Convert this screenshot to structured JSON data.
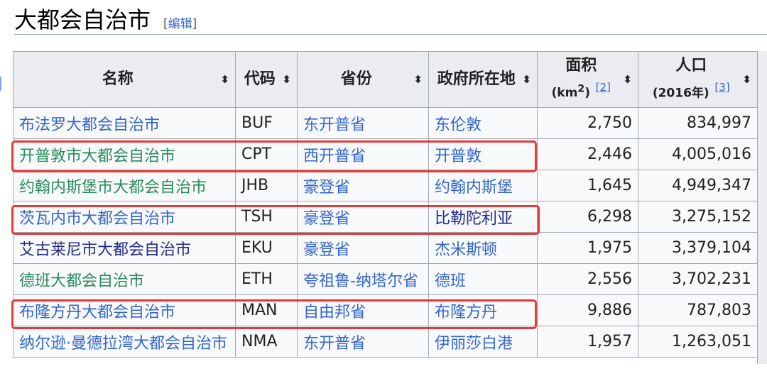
{
  "section": {
    "title": "大都会自治市",
    "edit_open": "[",
    "edit_label": "编辑",
    "edit_close": "]"
  },
  "table": {
    "headers": {
      "name": "名称",
      "code": "代码",
      "province": "省份",
      "seat": "政府所在地",
      "area_title": "面积",
      "area_unit_prefix": "(km",
      "area_unit_sup": "2",
      "area_unit_suffix": ")",
      "area_ref": "[2]",
      "pop_title": "人口",
      "pop_unit": "(2016年)",
      "pop_ref": "[3]"
    },
    "sort_icon": "sort-icon",
    "rows": [
      {
        "name": "布法罗大都会自治市",
        "code": "BUF",
        "province": "东开普省",
        "seat": "东伦敦",
        "area": "2,750",
        "population": "834,997"
      },
      {
        "name": "开普敦市大都会自治市",
        "code": "CPT",
        "province": "西开普省",
        "seat": "开普敦",
        "area": "2,446",
        "population": "4,005,016"
      },
      {
        "name": "约翰内斯堡市大都会自治市",
        "code": "JHB",
        "province": "豪登省",
        "seat": "约翰内斯堡",
        "area": "1,645",
        "population": "4,949,347"
      },
      {
        "name": "茨瓦内市大都会自治市",
        "code": "TSH",
        "province": "豪登省",
        "seat": "比勒陀利亚",
        "area": "6,298",
        "population": "3,275,152"
      },
      {
        "name": "艾古莱尼市大都会自治市",
        "code": "EKU",
        "province": "豪登省",
        "seat": "杰米斯顿",
        "area": "1,975",
        "population": "3,379,104"
      },
      {
        "name": "德班大都会自治市",
        "code": "ETH",
        "province": "夸祖鲁-纳塔尔省",
        "seat": "德班",
        "area": "2,556",
        "population": "3,702,231"
      },
      {
        "name": "布隆方丹大都会自治市",
        "code": "MAN",
        "province": "自由邦省",
        "seat": "布隆方丹",
        "area": "9,886",
        "population": "787,803"
      },
      {
        "name": "纳尔逊·曼德拉湾大都会自治市",
        "code": "NMA",
        "province": "东开普省",
        "seat": "伊丽莎白港",
        "area": "1,957",
        "population": "1,263,051"
      }
    ]
  },
  "colors": {
    "link": "#3366cc",
    "highlight": "#e53935",
    "header_bg": "#eaecf0",
    "cell_bg": "#f8f9fa"
  }
}
